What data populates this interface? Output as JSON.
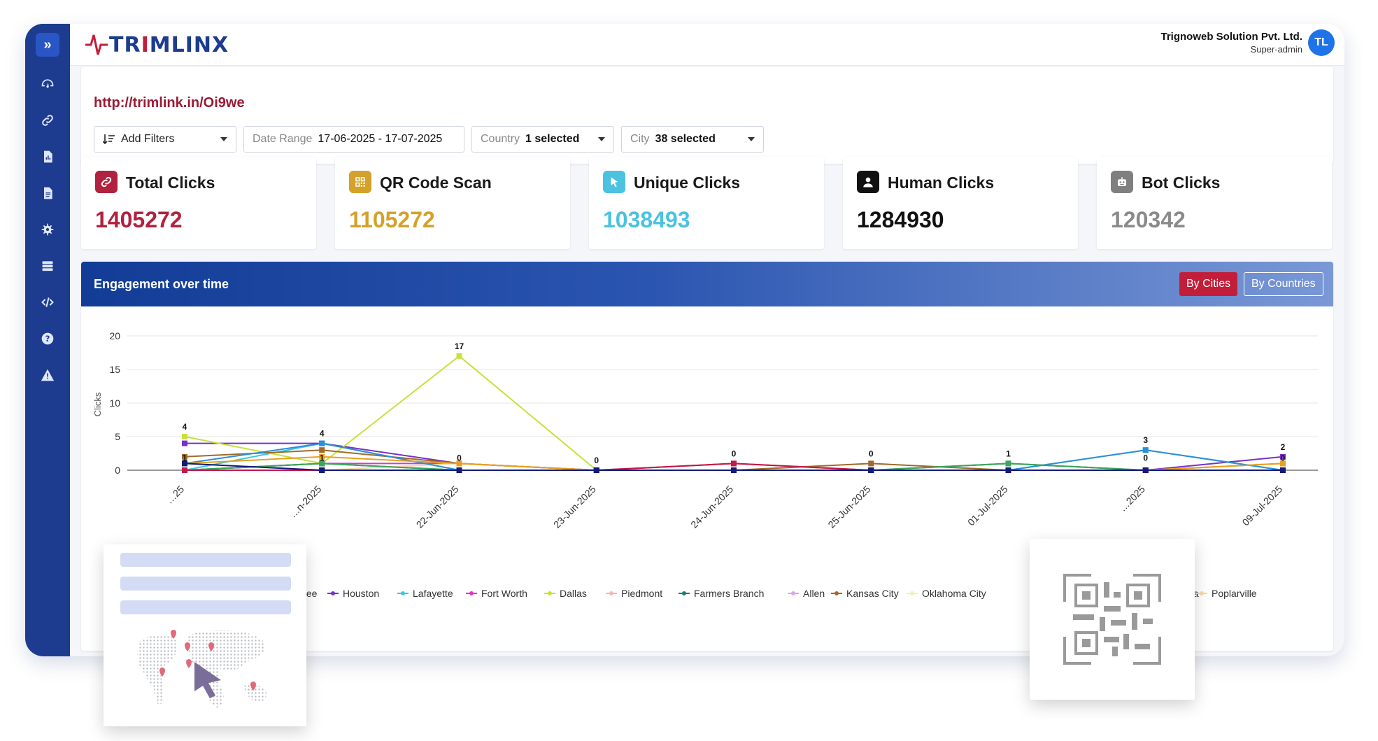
{
  "brand": {
    "name_prefix": "TR",
    "name_o": "I",
    "name_suffix": "MLINX"
  },
  "user": {
    "org": "Trignoweb Solution Pvt. Ltd.",
    "role": "Super-admin",
    "initials": "TL"
  },
  "short_url": "http://trimlink.in/Oi9we",
  "filters": {
    "add_filters": "Add Filters",
    "date_label": "Date Range",
    "date_value": "17-06-2025 - 17-07-2025",
    "country_label": "Country",
    "country_value": "1 selected",
    "city_label": "City",
    "city_value": "38 selected"
  },
  "stats": [
    {
      "title": "Total Clicks",
      "value": "1405272",
      "color": "#b0223f",
      "icon": "link-icon"
    },
    {
      "title": "QR Code Scan",
      "value": "1105272",
      "color": "#d4a12a",
      "icon": "qr-icon"
    },
    {
      "title": "Unique Clicks",
      "value": "1038493",
      "color": "#4bc2e0",
      "icon": "cursor-icon"
    },
    {
      "title": "Human Clicks",
      "value": "1284930",
      "color": "#111111",
      "icon": "user-icon"
    },
    {
      "title": "Bot Clicks",
      "value": "120342",
      "color": "#8a8a8a",
      "icon": "bot-icon"
    }
  ],
  "engagement": {
    "title": "Engagement over time",
    "toggle_cities": "By Cities",
    "toggle_countries": "By Countries"
  },
  "sidebar": {
    "items": [
      "dashboard-icon",
      "link-icon",
      "document-chart-icon",
      "document-icon",
      "gear-icon",
      "server-icon",
      "code-icon",
      "help-icon",
      "warning-icon"
    ]
  },
  "chart_data": {
    "type": "line",
    "ylabel": "Clicks",
    "ylim": [
      0,
      20
    ],
    "yticks": [
      0,
      5,
      10,
      15,
      20
    ],
    "categories": [
      "…25",
      "…n-2025",
      "22-Jun-2025",
      "23-Jun-2025",
      "24-Jun-2025",
      "25-Jun-2025",
      "01-Jul-2025",
      "…2025",
      "09-Jul-2025"
    ],
    "point_labels": [
      "4",
      "4",
      "17",
      "0",
      "0",
      "0",
      "1",
      "3",
      "2"
    ],
    "point_labels_extra": [
      {
        "index": 0,
        "text": "1"
      },
      {
        "index": 1,
        "text": "1"
      },
      {
        "index": 2,
        "text": "0"
      },
      {
        "index": 7,
        "text": "0"
      },
      {
        "index": 8,
        "text": "0"
      }
    ],
    "legend_visible": [
      "…wnee",
      "Houston",
      "Lafayette",
      "Fort Worth",
      "Dallas",
      "Piedmont",
      "Farmers Branch",
      "Allen",
      "Kansas City",
      "Oklahoma City",
      "…ta",
      "Poplarville"
    ],
    "series": [
      {
        "name": "Houston",
        "color": "#7a2fc8",
        "values": [
          4,
          4,
          1,
          0,
          0,
          0,
          0,
          0,
          2
        ]
      },
      {
        "name": "Lafayette",
        "color": "#3ec7e0",
        "values": [
          0,
          4,
          0,
          0,
          0,
          0,
          0,
          3,
          0
        ]
      },
      {
        "name": "Fort Worth",
        "color": "#d43acb",
        "values": [
          0,
          1,
          1,
          0,
          0,
          0,
          0,
          0,
          0
        ]
      },
      {
        "name": "Dallas",
        "color": "#c6e23a",
        "values": [
          5,
          1,
          17,
          0,
          0,
          0,
          0,
          0,
          0
        ]
      },
      {
        "name": "Piedmont",
        "color": "#f2b8b8",
        "values": [
          0,
          0,
          0,
          0,
          0,
          0,
          0,
          0,
          0
        ]
      },
      {
        "name": "Farmers Branch",
        "color": "#1e7a7a",
        "values": [
          0,
          1,
          0,
          0,
          0,
          0,
          1,
          0,
          0
        ]
      },
      {
        "name": "Allen",
        "color": "#d6a9e8",
        "values": [
          0,
          0,
          0,
          0,
          0,
          0,
          0,
          0,
          0
        ]
      },
      {
        "name": "Kansas City",
        "color": "#a06a2a",
        "values": [
          2,
          3,
          1,
          0,
          0,
          1,
          0,
          0,
          1
        ]
      },
      {
        "name": "Oklahoma City",
        "color": "#f5f0b0",
        "values": [
          0,
          0,
          0,
          0,
          0,
          0,
          0,
          0,
          0
        ]
      },
      {
        "name": "Poplarville",
        "color": "#f6d9a6",
        "values": [
          0,
          0,
          1,
          0,
          0,
          0,
          0,
          0,
          1
        ]
      },
      {
        "name": "",
        "color": "#2d8fd6",
        "values": [
          1,
          4,
          0,
          0,
          0,
          0,
          0,
          3,
          0
        ]
      },
      {
        "name": "",
        "color": "#e0402e",
        "values": [
          0,
          0,
          0,
          0,
          1,
          0,
          0,
          0,
          0
        ]
      },
      {
        "name": "",
        "color": "#3aa65a",
        "values": [
          0,
          1,
          0,
          0,
          0,
          0,
          1,
          0,
          0
        ]
      },
      {
        "name": "",
        "color": "#e8a020",
        "values": [
          1,
          2,
          1,
          0,
          0,
          0,
          0,
          0,
          1
        ]
      },
      {
        "name": "",
        "color": "#c2184a",
        "values": [
          0,
          0,
          0,
          0,
          1,
          0,
          0,
          0,
          0
        ]
      },
      {
        "name": "",
        "color": "#121a7a",
        "values": [
          1,
          0,
          0,
          0,
          0,
          0,
          0,
          0,
          0
        ]
      }
    ],
    "grid": true,
    "legend_position": "bottom"
  }
}
